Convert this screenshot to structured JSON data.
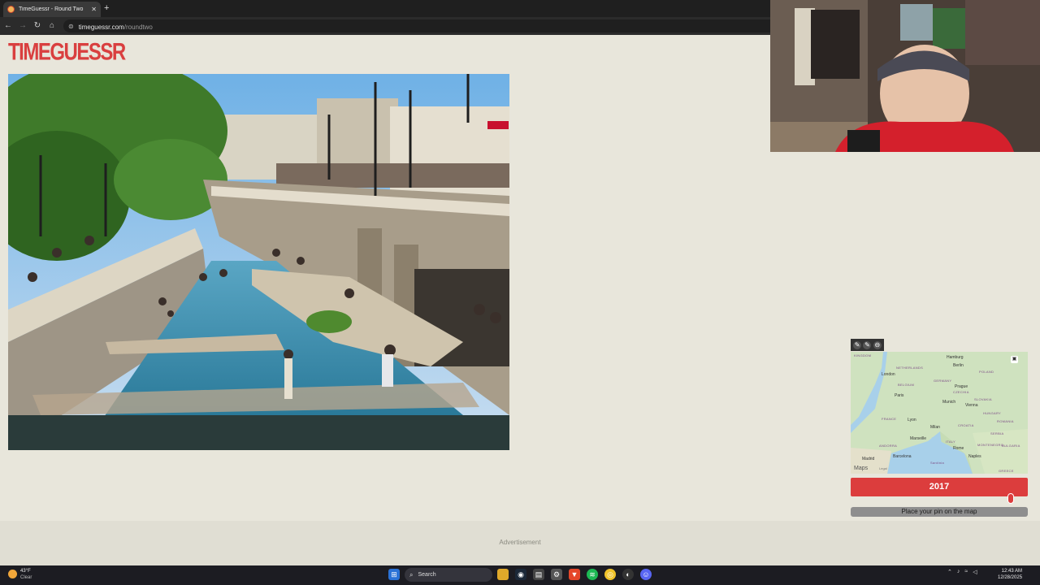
{
  "browser": {
    "tab_title": "TimeGuessr - Round Two",
    "tab_close": "✕",
    "new_tab": "+",
    "url_host": "timeguessr.com",
    "url_path": "/roundtwo"
  },
  "page": {
    "logo": "TIMEGUESSR",
    "advertisement": "Advertisement"
  },
  "map": {
    "labels": [
      {
        "text": "KINGDOM",
        "type": "country"
      },
      {
        "text": "Hamburg",
        "type": "city"
      },
      {
        "text": "NETHERLANDS",
        "type": "country"
      },
      {
        "text": "Berlin",
        "type": "city"
      },
      {
        "text": "POLAND",
        "type": "country"
      },
      {
        "text": "London",
        "type": "city"
      },
      {
        "text": "GERMANY",
        "type": "country"
      },
      {
        "text": "BELGIUM",
        "type": "country"
      },
      {
        "text": "Prague",
        "type": "city"
      },
      {
        "text": "Paris",
        "type": "city"
      },
      {
        "text": "CZECHIA",
        "type": "country"
      },
      {
        "text": "Munich",
        "type": "city"
      },
      {
        "text": "SLOVAKIA",
        "type": "country"
      },
      {
        "text": "Vienna",
        "type": "city"
      },
      {
        "text": "HUNGARY",
        "type": "country"
      },
      {
        "text": "FRANCE",
        "type": "country"
      },
      {
        "text": "Lyon",
        "type": "city"
      },
      {
        "text": "Milan",
        "type": "city"
      },
      {
        "text": "CROATIA",
        "type": "country"
      },
      {
        "text": "ROMANIA",
        "type": "country"
      },
      {
        "text": "Marseille",
        "type": "city"
      },
      {
        "text": "SERBIA",
        "type": "country"
      },
      {
        "text": "ANDORRA",
        "type": "country"
      },
      {
        "text": "ITALY",
        "type": "country"
      },
      {
        "text": "Rome",
        "type": "city"
      },
      {
        "text": "MONTENEGRO",
        "type": "country"
      },
      {
        "text": "BULGARIA",
        "type": "country"
      },
      {
        "text": "Barcelona",
        "type": "city"
      },
      {
        "text": "Madrid",
        "type": "city"
      },
      {
        "text": "Naples",
        "type": "city"
      },
      {
        "text": "Sardinia",
        "type": "country"
      },
      {
        "text": "GREECE",
        "type": "country"
      }
    ],
    "brand": "Maps",
    "legal": "Legal",
    "tools": [
      "✎",
      "✎",
      "⊖"
    ]
  },
  "year": "2017",
  "year_slider_fraction": 0.92,
  "pin_button": "Place your pin on the map",
  "taskbar": {
    "temp": "43°F",
    "condition": "Clear",
    "search": "Search",
    "time": "12:43 AM",
    "date": "12/28/2025"
  },
  "colors": {
    "accent": "#dc3d3d",
    "page_bg": "#e8e6db",
    "button_grey": "#8e8e8e"
  }
}
